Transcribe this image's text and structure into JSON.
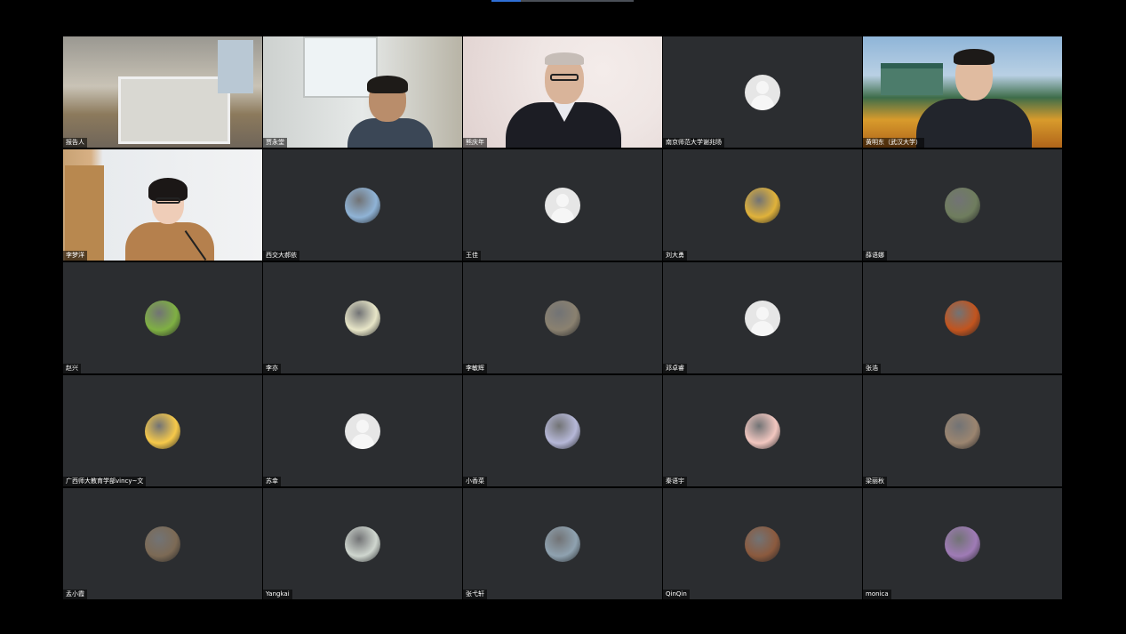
{
  "colors": {
    "background": "#000000",
    "tile": "#2b2d30",
    "active_speaker_border": "#3bd16f",
    "name_text": "#ffffff",
    "top_indicator": "#2f6fd6"
  },
  "participants": [
    {
      "name": "报告人",
      "type": "video",
      "scene": "room",
      "active": true
    },
    {
      "name": "贾永堂",
      "type": "video",
      "scene": "office"
    },
    {
      "name": "熊庆年",
      "type": "video",
      "scene": "studio"
    },
    {
      "name": "南京师范大学谢兆旸",
      "type": "avatar",
      "avatar": "default-avatar-icon"
    },
    {
      "name": "黄明东（武汉大学）",
      "type": "video",
      "scene": "campus"
    },
    {
      "name": "李梦洋",
      "type": "video",
      "scene": "homeoffice"
    },
    {
      "name": "西交大郝依",
      "type": "avatar",
      "avatar": "mountain-painting-avatar",
      "color": "#8fb3d6"
    },
    {
      "name": "王佳",
      "type": "avatar",
      "avatar": "default-avatar-icon"
    },
    {
      "name": "刘大勇",
      "type": "avatar",
      "avatar": "yellow-duck-avatar",
      "color": "#e0b23a"
    },
    {
      "name": "薛语娜",
      "type": "avatar",
      "avatar": "forest-avatar",
      "color": "#6f7d5e"
    },
    {
      "name": "赵兴",
      "type": "avatar",
      "avatar": "green-field-avatar",
      "color": "#7fb043"
    },
    {
      "name": "李亦",
      "type": "avatar",
      "avatar": "white-flower-avatar",
      "color": "#e8e6c8"
    },
    {
      "name": "李敏辉",
      "type": "avatar",
      "avatar": "building-photo-avatar",
      "color": "#8a8170"
    },
    {
      "name": "邓卓睿",
      "type": "avatar",
      "avatar": "default-avatar-icon"
    },
    {
      "name": "张浩",
      "type": "avatar",
      "avatar": "autumn-leaves-avatar",
      "color": "#c2541e"
    },
    {
      "name": "广西师大教育学部vincy~文",
      "type": "avatar",
      "avatar": "cartoon-duck-avatar",
      "color": "#f6c94a"
    },
    {
      "name": "苏幸",
      "type": "avatar",
      "avatar": "default-avatar-icon"
    },
    {
      "name": "小香菜",
      "type": "avatar",
      "avatar": "anime-girl-avatar",
      "color": "#b6b8d8"
    },
    {
      "name": "秦语宇",
      "type": "avatar",
      "avatar": "cartoon-pig-avatar",
      "color": "#f2c7c0"
    },
    {
      "name": "梁丽秋",
      "type": "avatar",
      "avatar": "hedgehog-avatar",
      "color": "#9b8570"
    },
    {
      "name": "孟小霞",
      "type": "avatar",
      "avatar": "hands-plant-avatar",
      "color": "#7c6a55"
    },
    {
      "name": "Yangkai",
      "type": "avatar",
      "avatar": "bride-photo-avatar",
      "color": "#cfd6cf"
    },
    {
      "name": "张弋轩",
      "type": "avatar",
      "avatar": "portrait-avatar",
      "color": "#8fa2b0"
    },
    {
      "name": "QinQin",
      "type": "avatar",
      "avatar": "brown-bear-avatar",
      "color": "#8b5a3e"
    },
    {
      "name": "monica",
      "type": "avatar",
      "avatar": "cartoon-girl-avatar",
      "color": "#9f7bb6"
    }
  ]
}
